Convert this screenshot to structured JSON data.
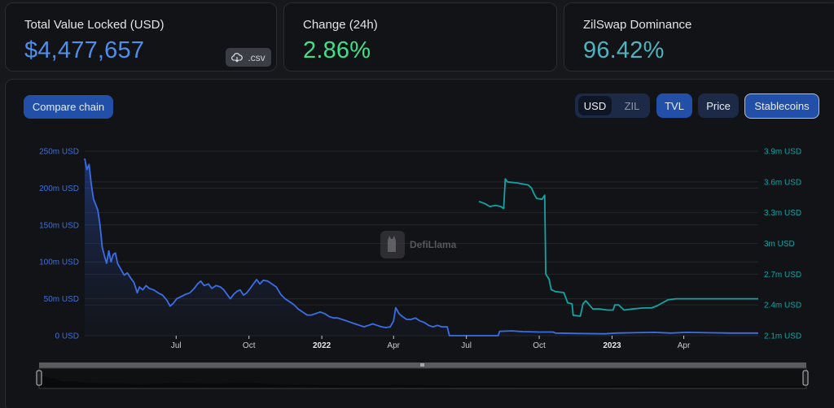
{
  "stats": {
    "tvl": {
      "label": "Total Value Locked (USD)",
      "value": "$4,477,657",
      "color": "#4f8fea",
      "csv_label": ".csv"
    },
    "change": {
      "label": "Change (24h)",
      "value": "2.86%",
      "color": "#3ee08a"
    },
    "dominance": {
      "label": "ZilSwap Dominance",
      "value": "96.42%",
      "color": "#4fb3bf"
    }
  },
  "controls": {
    "compare_label": "Compare chain",
    "denom_usd": "USD",
    "denom_zil": "ZIL",
    "tvl_label": "TVL",
    "price_label": "Price",
    "stablecoins_label": "Stablecoins"
  },
  "watermark": "DefiLlama",
  "chart_data": {
    "type": "line",
    "title": "",
    "left_axis": {
      "ticks": [
        "250m USD",
        "200m USD",
        "150m USD",
        "100m USD",
        "50m USD",
        "0 USD"
      ],
      "range": [
        0,
        250
      ],
      "unit": "m USD",
      "color": "#3f6fd8"
    },
    "right_axis": {
      "ticks": [
        "3.9m USD",
        "3.6m USD",
        "3.3m USD",
        "3m USD",
        "2.7m USD",
        "2.4m USD",
        "2.1m USD"
      ],
      "range": [
        2.1,
        3.9
      ],
      "unit": "m USD",
      "color": "#14a3a3"
    },
    "x_ticks": [
      {
        "label": "Jul",
        "bold": false,
        "t": 0.167
      },
      {
        "label": "Oct",
        "bold": false,
        "t": 0.3
      },
      {
        "label": "2022",
        "bold": true,
        "t": 0.433
      },
      {
        "label": "Apr",
        "bold": false,
        "t": 0.564
      },
      {
        "label": "Jul",
        "bold": false,
        "t": 0.697
      },
      {
        "label": "Oct",
        "bold": false,
        "t": 0.83
      },
      {
        "label": "2023",
        "bold": true,
        "t": 0.963
      },
      {
        "label": "Apr",
        "bold": false,
        "t": 1.094
      }
    ],
    "x_domain_note": "t is a time fraction (0 = series start ~Apr 2021, 1.0 = ~Jan 2023, 1.23 = series end ~Jun 2023)",
    "x_range": [
      0,
      1.23
    ],
    "series": [
      {
        "name": "TVL",
        "axis": "left",
        "color": "#3a6ee8",
        "points": [
          [
            0.0,
            240
          ],
          [
            0.004,
            225
          ],
          [
            0.008,
            232
          ],
          [
            0.012,
            205
          ],
          [
            0.016,
            185
          ],
          [
            0.02,
            178
          ],
          [
            0.024,
            170
          ],
          [
            0.028,
            150
          ],
          [
            0.032,
            120
          ],
          [
            0.036,
            108
          ],
          [
            0.04,
            98
          ],
          [
            0.044,
            115
          ],
          [
            0.048,
            100
          ],
          [
            0.052,
            110
          ],
          [
            0.056,
            112
          ],
          [
            0.06,
            98
          ],
          [
            0.066,
            90
          ],
          [
            0.072,
            82
          ],
          [
            0.078,
            85
          ],
          [
            0.084,
            78
          ],
          [
            0.09,
            72
          ],
          [
            0.096,
            58
          ],
          [
            0.1,
            66
          ],
          [
            0.106,
            62
          ],
          [
            0.112,
            68
          ],
          [
            0.118,
            64
          ],
          [
            0.126,
            62
          ],
          [
            0.134,
            58
          ],
          [
            0.142,
            55
          ],
          [
            0.15,
            48
          ],
          [
            0.156,
            40
          ],
          [
            0.162,
            44
          ],
          [
            0.168,
            50
          ],
          [
            0.176,
            53
          ],
          [
            0.184,
            56
          ],
          [
            0.192,
            58
          ],
          [
            0.2,
            64
          ],
          [
            0.206,
            70
          ],
          [
            0.212,
            74
          ],
          [
            0.218,
            68
          ],
          [
            0.226,
            70
          ],
          [
            0.232,
            64
          ],
          [
            0.24,
            68
          ],
          [
            0.248,
            66
          ],
          [
            0.254,
            62
          ],
          [
            0.26,
            56
          ],
          [
            0.266,
            50
          ],
          [
            0.272,
            56
          ],
          [
            0.278,
            60
          ],
          [
            0.284,
            62
          ],
          [
            0.29,
            55
          ],
          [
            0.296,
            58
          ],
          [
            0.302,
            64
          ],
          [
            0.308,
            70
          ],
          [
            0.314,
            76
          ],
          [
            0.32,
            70
          ],
          [
            0.326,
            75
          ],
          [
            0.334,
            74
          ],
          [
            0.342,
            70
          ],
          [
            0.35,
            66
          ],
          [
            0.358,
            56
          ],
          [
            0.366,
            50
          ],
          [
            0.374,
            46
          ],
          [
            0.382,
            42
          ],
          [
            0.39,
            36
          ],
          [
            0.398,
            32
          ],
          [
            0.406,
            28
          ],
          [
            0.414,
            28
          ],
          [
            0.422,
            30
          ],
          [
            0.43,
            32
          ],
          [
            0.438,
            30
          ],
          [
            0.446,
            26
          ],
          [
            0.454,
            24
          ],
          [
            0.462,
            24
          ],
          [
            0.47,
            22
          ],
          [
            0.478,
            20
          ],
          [
            0.486,
            18
          ],
          [
            0.494,
            16
          ],
          [
            0.502,
            14
          ],
          [
            0.51,
            12
          ],
          [
            0.518,
            14
          ],
          [
            0.526,
            16
          ],
          [
            0.534,
            14
          ],
          [
            0.542,
            12
          ],
          [
            0.55,
            11
          ],
          [
            0.558,
            12
          ],
          [
            0.564,
            20
          ],
          [
            0.568,
            38
          ],
          [
            0.574,
            30
          ],
          [
            0.58,
            26
          ],
          [
            0.588,
            22
          ],
          [
            0.596,
            22
          ],
          [
            0.604,
            24
          ],
          [
            0.612,
            20
          ],
          [
            0.62,
            18
          ],
          [
            0.628,
            14
          ],
          [
            0.636,
            12
          ],
          [
            0.644,
            14
          ],
          [
            0.652,
            12
          ],
          [
            0.662,
            12
          ],
          [
            0.666,
            0
          ],
          [
            0.7,
            0
          ],
          [
            0.755,
            0
          ],
          [
            0.758,
            6
          ],
          [
            0.78,
            6.5
          ],
          [
            0.8,
            5.5
          ],
          [
            0.83,
            5
          ],
          [
            0.855,
            5
          ],
          [
            0.86,
            3.5
          ],
          [
            0.9,
            3
          ],
          [
            0.95,
            2.5
          ],
          [
            0.97,
            3.5
          ],
          [
            1.0,
            4
          ],
          [
            1.04,
            4.5
          ],
          [
            1.07,
            3.5
          ],
          [
            1.1,
            4.5
          ],
          [
            1.14,
            4
          ],
          [
            1.18,
            3.5
          ],
          [
            1.23,
            3.5
          ]
        ]
      },
      {
        "name": "Stablecoins",
        "axis": "right",
        "color": "#14a3a3",
        "points": [
          [
            0.72,
            3.41
          ],
          [
            0.73,
            3.39
          ],
          [
            0.74,
            3.36
          ],
          [
            0.75,
            3.37
          ],
          [
            0.76,
            3.36
          ],
          [
            0.765,
            3.34
          ],
          [
            0.768,
            3.63
          ],
          [
            0.772,
            3.6
          ],
          [
            0.79,
            3.59
          ],
          [
            0.81,
            3.57
          ],
          [
            0.816,
            3.54
          ],
          [
            0.82,
            3.49
          ],
          [
            0.825,
            3.44
          ],
          [
            0.835,
            3.43
          ],
          [
            0.84,
            3.47
          ],
          [
            0.842,
            2.7
          ],
          [
            0.848,
            2.65
          ],
          [
            0.852,
            2.55
          ],
          [
            0.86,
            2.53
          ],
          [
            0.875,
            2.52
          ],
          [
            0.882,
            2.42
          ],
          [
            0.89,
            2.41
          ],
          [
            0.892,
            2.3
          ],
          [
            0.905,
            2.29
          ],
          [
            0.91,
            2.41
          ],
          [
            0.915,
            2.44
          ],
          [
            0.92,
            2.41
          ],
          [
            0.928,
            2.36
          ],
          [
            0.94,
            2.36
          ],
          [
            0.955,
            2.35
          ],
          [
            0.965,
            2.35
          ],
          [
            0.968,
            2.4
          ],
          [
            0.975,
            2.4
          ],
          [
            0.985,
            2.35
          ],
          [
            1.0,
            2.36
          ],
          [
            1.02,
            2.37
          ],
          [
            1.035,
            2.37
          ],
          [
            1.045,
            2.39
          ],
          [
            1.055,
            2.42
          ],
          [
            1.065,
            2.45
          ],
          [
            1.08,
            2.46
          ],
          [
            1.1,
            2.46
          ],
          [
            1.15,
            2.46
          ],
          [
            1.23,
            2.46
          ]
        ]
      }
    ]
  }
}
